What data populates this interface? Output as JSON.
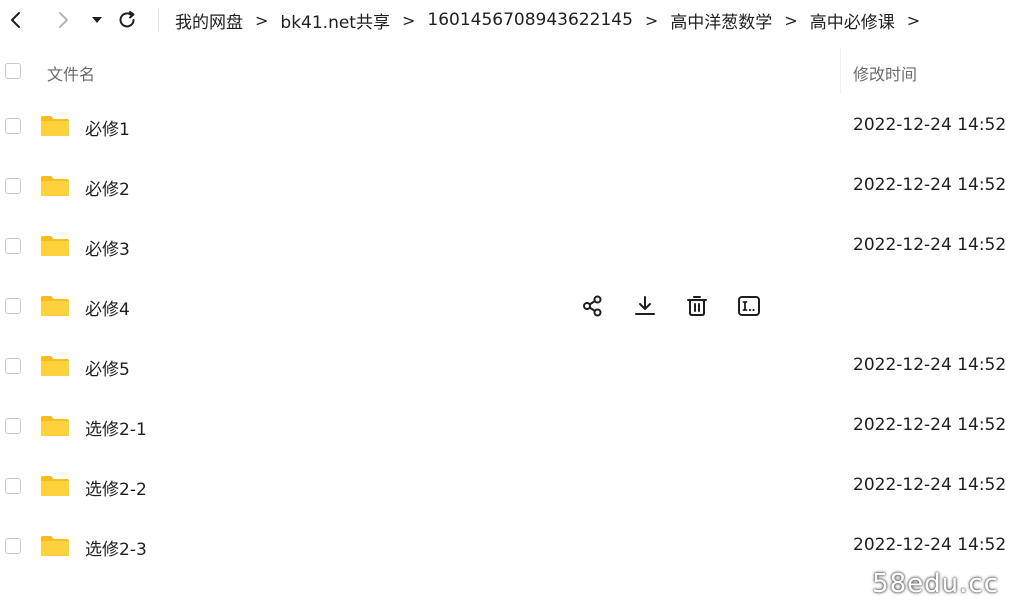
{
  "nav": {
    "back_icon": "chevron-left-icon",
    "forward_icon": "chevron-right-icon",
    "dropdown_icon": "caret-down-icon",
    "refresh_icon": "refresh-icon"
  },
  "breadcrumb": [
    "我的网盘",
    "bk41.net共享",
    "1601456708943622145",
    "高中洋葱数学",
    "高中必修课"
  ],
  "breadcrumb_sep": ">",
  "header": {
    "name_col": "文件名",
    "time_col": "修改时间"
  },
  "files": [
    {
      "name": "必修1",
      "time": "2022-12-24 14:52"
    },
    {
      "name": "必修2",
      "time": "2022-12-24 14:52"
    },
    {
      "name": "必修3",
      "time": "2022-12-24 14:52"
    },
    {
      "name": "必修4",
      "time": ""
    },
    {
      "name": "必修5",
      "time": "2022-12-24 14:52"
    },
    {
      "name": "选修2-1",
      "time": "2022-12-24 14:52"
    },
    {
      "name": "选修2-2",
      "time": "2022-12-24 14:52"
    },
    {
      "name": "选修2-3",
      "time": "2022-12-24 14:52"
    }
  ],
  "hover_actions": [
    "share-icon",
    "download-icon",
    "delete-icon",
    "rename-icon"
  ],
  "colors": {
    "folder": "#FFD23C",
    "folder_tab": "#F5BD1F",
    "text": "#1f1f1f",
    "muted": "#6b6b6b"
  },
  "watermark": "58edu.cc"
}
